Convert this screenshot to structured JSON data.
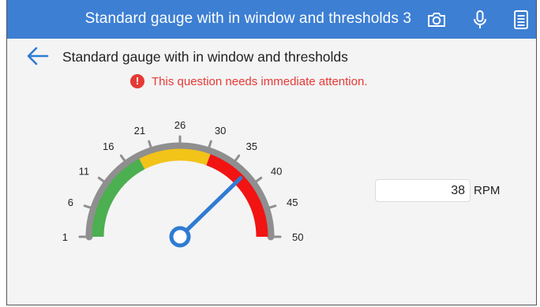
{
  "topbar": {
    "title": "Standard gauge with in window and thresholds 3",
    "icons": [
      "camera-icon",
      "microphone-icon",
      "notes-icon"
    ],
    "background": "#3d7fd3"
  },
  "page": {
    "title": "Standard gauge with in window and thresholds"
  },
  "alert": {
    "icon": "!",
    "text": "This question needs immediate attention.",
    "color": "#e53935"
  },
  "gauge": {
    "min": 1,
    "max": 50,
    "value": 38,
    "tick_labels": [
      "1",
      "6",
      "11",
      "16",
      "21",
      "26",
      "30",
      "35",
      "40",
      "45",
      "50"
    ],
    "zones": [
      {
        "name": "green",
        "from": 1,
        "to": 18,
        "color": "#4caf50"
      },
      {
        "name": "yellow",
        "from": 18,
        "to": 31,
        "color": "#f2c318"
      },
      {
        "name": "red",
        "from": 31,
        "to": 50,
        "color": "#f21313"
      }
    ],
    "needle_color": "#2f7bd3",
    "track_color": "#8f8f8f"
  },
  "reading": {
    "value": "38",
    "unit": "RPM"
  }
}
